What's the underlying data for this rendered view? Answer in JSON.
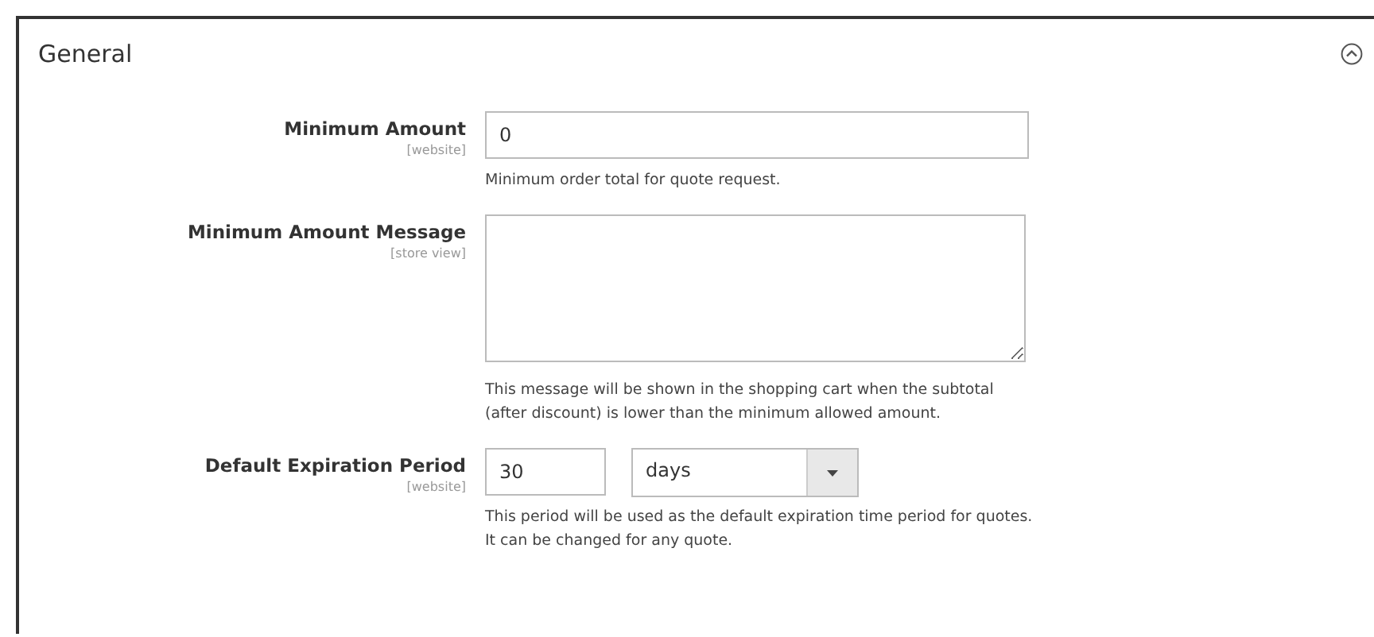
{
  "section": {
    "title": "General",
    "expanded": true
  },
  "fields": [
    {
      "kind": "text",
      "label": "Minimum Amount",
      "scope": "[website]",
      "value": "0",
      "note": "Minimum order total for quote request."
    },
    {
      "kind": "textarea",
      "label": "Minimum Amount Message",
      "scope": "[store view]",
      "note": "This message will be shown in the shopping cart when the subtotal (after discount) is lower than the minimum allowed amount."
    },
    {
      "kind": "period",
      "label": "Default Expiration Period",
      "scope": "[website]",
      "value": "30",
      "unit": "days",
      "note": "This period will be used as the default expiration time period for quotes. It can be changed for any quote."
    }
  ]
}
